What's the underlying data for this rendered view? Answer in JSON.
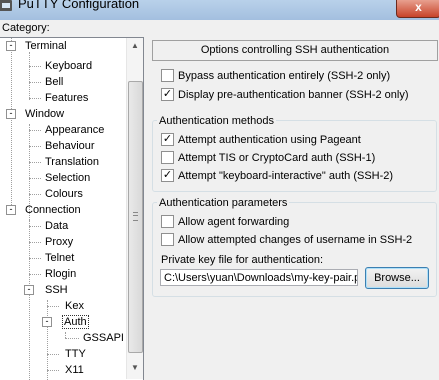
{
  "window": {
    "title": "PuTTY Configuration",
    "close_label": "x"
  },
  "category_label": "Category:",
  "tree": {
    "items": [
      {
        "label": "Terminal",
        "expander": "-"
      },
      {
        "label": "Keyboard"
      },
      {
        "label": "Bell"
      },
      {
        "label": "Features"
      },
      {
        "label": "Window",
        "expander": "-"
      },
      {
        "label": "Appearance"
      },
      {
        "label": "Behaviour"
      },
      {
        "label": "Translation"
      },
      {
        "label": "Selection"
      },
      {
        "label": "Colours"
      },
      {
        "label": "Connection",
        "expander": "-"
      },
      {
        "label": "Data"
      },
      {
        "label": "Proxy"
      },
      {
        "label": "Telnet"
      },
      {
        "label": "Rlogin"
      },
      {
        "label": "SSH",
        "expander": "-"
      },
      {
        "label": "Kex"
      },
      {
        "label": "Auth",
        "expander": "-",
        "selected": true
      },
      {
        "label": "GSSAPI"
      },
      {
        "label": "TTY"
      },
      {
        "label": "X11"
      }
    ]
  },
  "panel": {
    "header": "Options controlling SSH authentication",
    "bypass": {
      "label": "Bypass authentication entirely (SSH-2 only)",
      "checked": false
    },
    "banner": {
      "label": "Display pre-authentication banner (SSH-2 only)",
      "checked": true
    },
    "methods": {
      "title": "Authentication methods",
      "pageant": {
        "label": "Attempt authentication using Pageant",
        "checked": true
      },
      "tis": {
        "label": "Attempt TIS or CryptoCard auth (SSH-1)",
        "checked": false
      },
      "kbd": {
        "label": "Attempt \"keyboard-interactive\" auth (SSH-2)",
        "checked": true
      }
    },
    "params": {
      "title": "Authentication parameters",
      "agent_fwd": {
        "label": "Allow agent forwarding",
        "checked": false
      },
      "username_change": {
        "label": "Allow attempted changes of username in SSH-2",
        "checked": false
      },
      "key_label": "Private key file for authentication:",
      "key_value": "C:\\Users\\yuan\\Downloads\\my-key-pair.ppk",
      "browse_label": "Browse..."
    }
  },
  "check_mark": "✓"
}
